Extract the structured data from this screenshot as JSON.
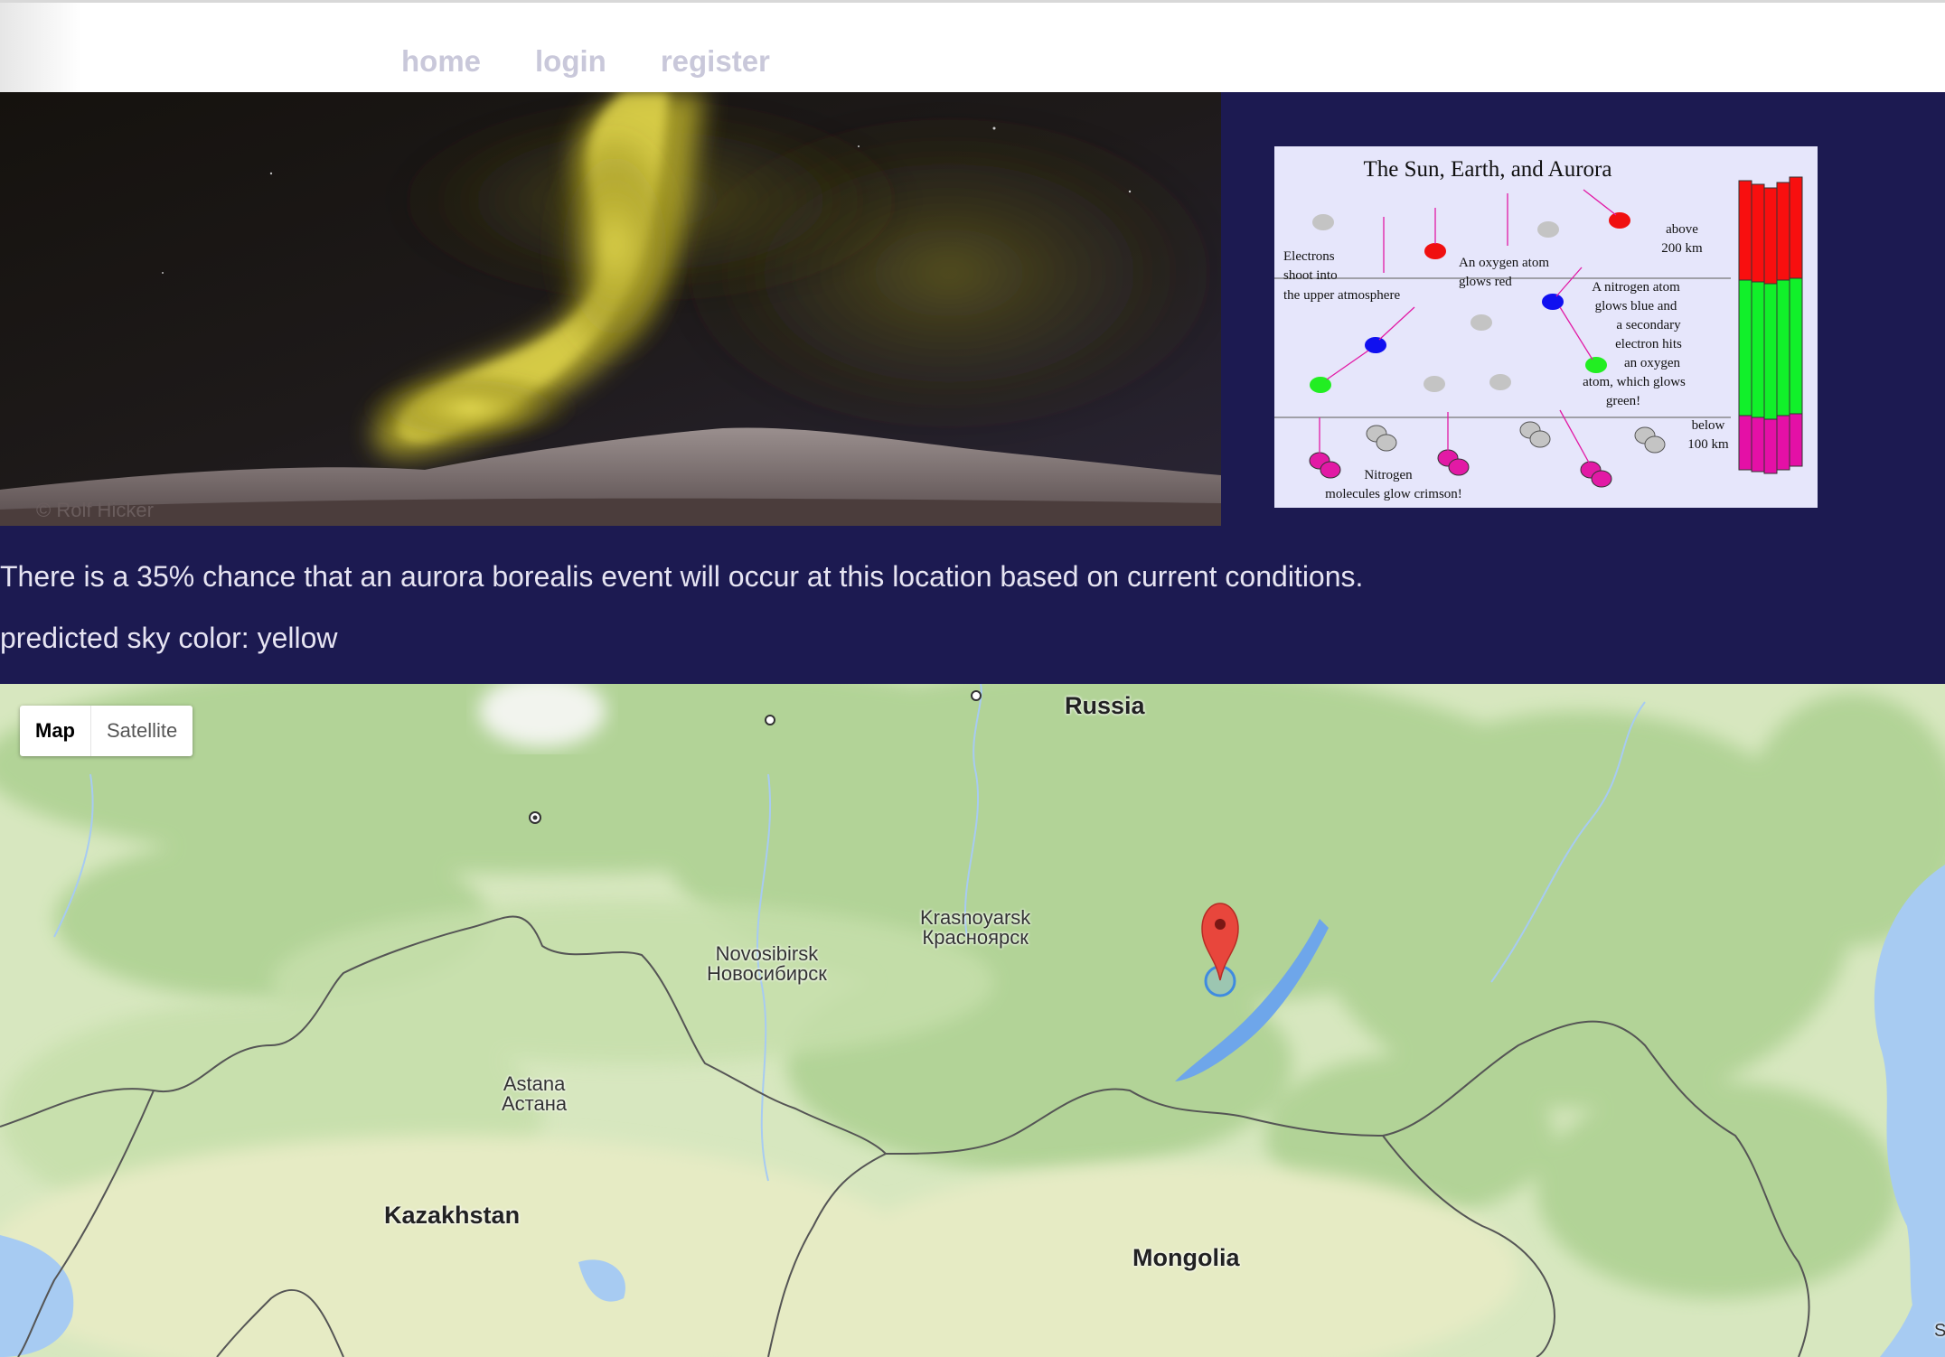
{
  "nav": {
    "home": "home",
    "login": "login",
    "register": "register"
  },
  "aurora_photo": {
    "watermark": "© Rolf Hicker"
  },
  "diagram": {
    "title": "The Sun, Earth, and Aurora",
    "above": [
      "above",
      "200 km"
    ],
    "below": [
      "below",
      "100 km"
    ],
    "electrons": [
      "Electrons",
      "shoot into",
      "the upper atmosphere"
    ],
    "oxygen": [
      "An oxygen atom",
      "glows red"
    ],
    "nitrogen": [
      "A nitrogen atom",
      "glows blue and",
      "a secondary",
      "electron hits",
      "an oxygen",
      "atom, which glows",
      "green!"
    ],
    "molecules": [
      "Nitrogen",
      "molecules glow crimson!"
    ]
  },
  "forecast": {
    "chance_text": "There is a 35% chance that an aurora borealis event will occur at this location based on current conditions.",
    "color_text": "predicted sky color: yellow"
  },
  "map": {
    "type_buttons": {
      "map": "Map",
      "satellite": "Satellite"
    },
    "countries": {
      "russia": "Russia",
      "kazakhstan": "Kazakhstan",
      "mongolia": "Mongolia"
    },
    "cities": {
      "novosibirsk": [
        "Novosibirsk",
        "Новосибирск"
      ],
      "krasnoyarsk": [
        "Krasnoyarsk",
        "Красноярск"
      ],
      "astana": [
        "Astana",
        "Астана"
      ]
    },
    "corner_text": "S",
    "colors": {
      "land": "#d5e6bd",
      "forest": "#a9cf8f",
      "water": "#a5c9f1",
      "border": "#555555",
      "marker": "#e8463c"
    }
  }
}
